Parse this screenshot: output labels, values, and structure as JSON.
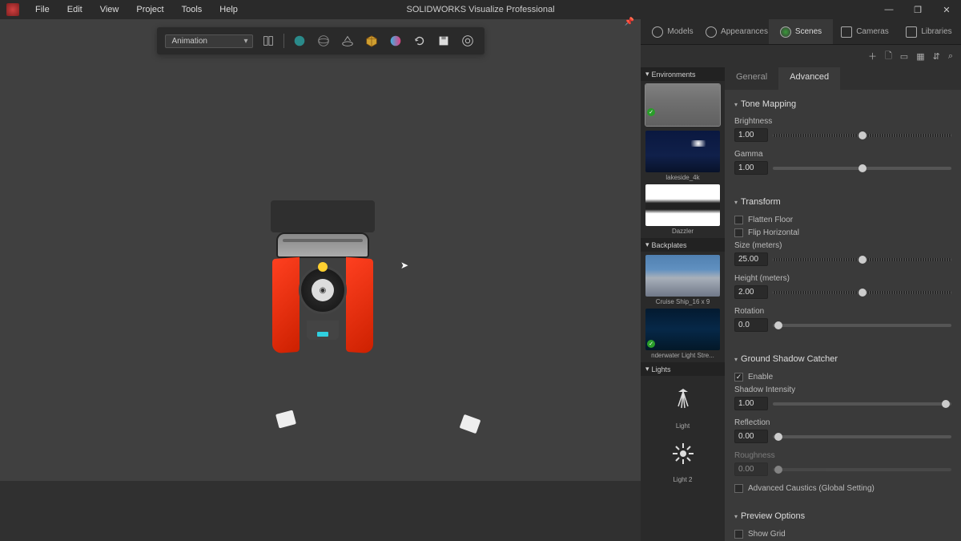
{
  "app": {
    "title": "SOLIDWORKS Visualize Professional"
  },
  "menu": {
    "file": "File",
    "edit": "Edit",
    "view": "View",
    "project": "Project",
    "tools": "Tools",
    "help": "Help"
  },
  "toolbar": {
    "mode": "Animation"
  },
  "rightTabs": {
    "models": "Models",
    "appearances": "Appearances",
    "scenes": "Scenes",
    "cameras": "Cameras",
    "libraries": "Libraries"
  },
  "browser": {
    "environments": {
      "header": "Environments",
      "items": [
        "",
        "lakeside_4k",
        "Dazzler"
      ]
    },
    "backplates": {
      "header": "Backplates",
      "items": [
        "Cruise Ship_16 x 9",
        "nderwater Light Stre..."
      ]
    },
    "lights": {
      "header": "Lights",
      "items": [
        "Light",
        "Light 2"
      ]
    }
  },
  "propTabs": {
    "general": "General",
    "advanced": "Advanced"
  },
  "sections": {
    "toneMapping": {
      "title": "Tone Mapping",
      "brightness": {
        "label": "Brightness",
        "value": "1.00"
      },
      "gamma": {
        "label": "Gamma",
        "value": "1.00"
      }
    },
    "transform": {
      "title": "Transform",
      "flattenFloor": "Flatten Floor",
      "flipHorizontal": "Flip Horizontal",
      "size": {
        "label": "Size (meters)",
        "value": "25.00"
      },
      "height": {
        "label": "Height (meters)",
        "value": "2.00"
      },
      "rotation": {
        "label": "Rotation",
        "value": "0.0"
      }
    },
    "shadow": {
      "title": "Ground Shadow Catcher",
      "enable": "Enable",
      "intensity": {
        "label": "Shadow Intensity",
        "value": "1.00"
      },
      "reflection": {
        "label": "Reflection",
        "value": "0.00"
      },
      "roughness": {
        "label": "Roughness",
        "value": "0.00"
      },
      "caustics": "Advanced Caustics (Global Setting)"
    },
    "preview": {
      "title": "Preview Options",
      "showGrid": "Show Grid"
    }
  }
}
